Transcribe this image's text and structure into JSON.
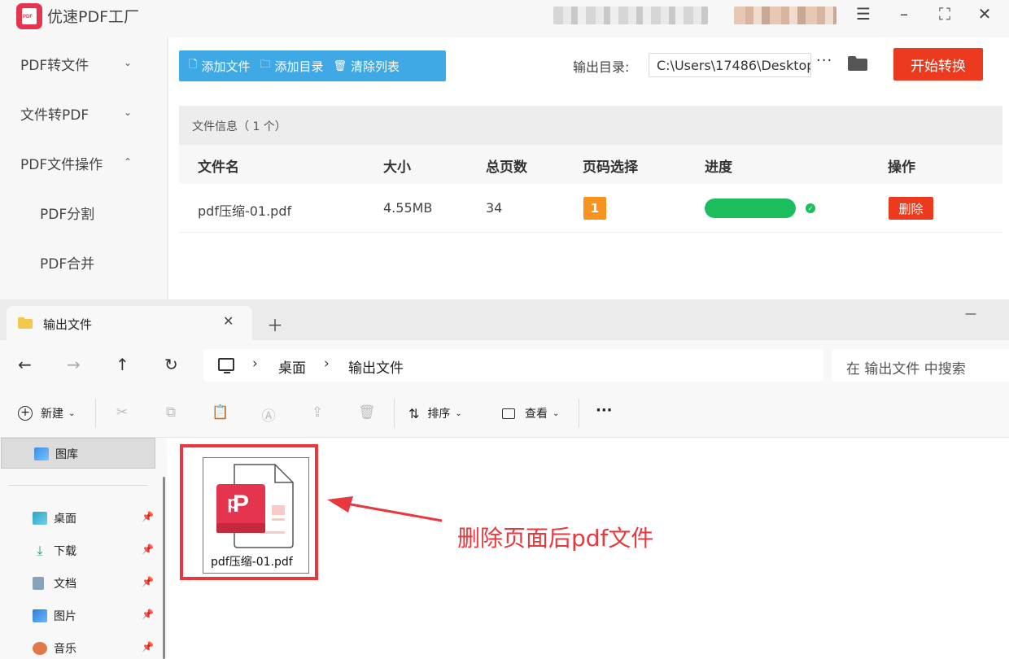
{
  "app": {
    "title": "优速PDF工厂",
    "sidebar": {
      "items": [
        {
          "label": "PDF转文件",
          "chevron": "chevron-down"
        },
        {
          "label": "文件转PDF",
          "chevron": "chevron-down"
        },
        {
          "label": "PDF文件操作",
          "chevron": "chevron-up"
        }
      ],
      "sub_items": [
        "PDF分割",
        "PDF合并"
      ]
    },
    "toolbar": {
      "add_file": "添加文件",
      "add_folder": "添加目录",
      "clear_list": "清除列表",
      "output_label": "输出目录:",
      "output_path": "C:\\Users\\17486\\Desktop",
      "more": "···",
      "start": "开始转换"
    },
    "file_info": "文件信息（ 1 个）",
    "table": {
      "headers": [
        "文件名",
        "大小",
        "总页数",
        "页码选择",
        "进度",
        "操作"
      ],
      "row": {
        "name": "pdf压缩-01.pdf",
        "size": "4.55MB",
        "pages": "34",
        "page_select": "1",
        "progress": 1.0,
        "action": "删除"
      }
    },
    "colors": {
      "accent": "#3fa9e6",
      "start": "#ec3a1f",
      "progress": "#1bbd5c",
      "badge": "#f7931e"
    }
  },
  "explorer": {
    "tab_title": "输出文件",
    "address": {
      "crumbs": [
        "桌面",
        "输出文件"
      ]
    },
    "search_placeholder": "在 输出文件 中搜索",
    "commands": {
      "new": "新建",
      "sort": "排序",
      "view": "查看",
      "more": "···"
    },
    "nav": {
      "gallery": "图库",
      "items": [
        "桌面",
        "下载",
        "文档",
        "图片",
        "音乐"
      ]
    },
    "file": {
      "name": "pdf压缩-01.pdf"
    },
    "annotation": "删除页面后pdf文件",
    "colors": {
      "highlight": "#e8383d"
    }
  }
}
